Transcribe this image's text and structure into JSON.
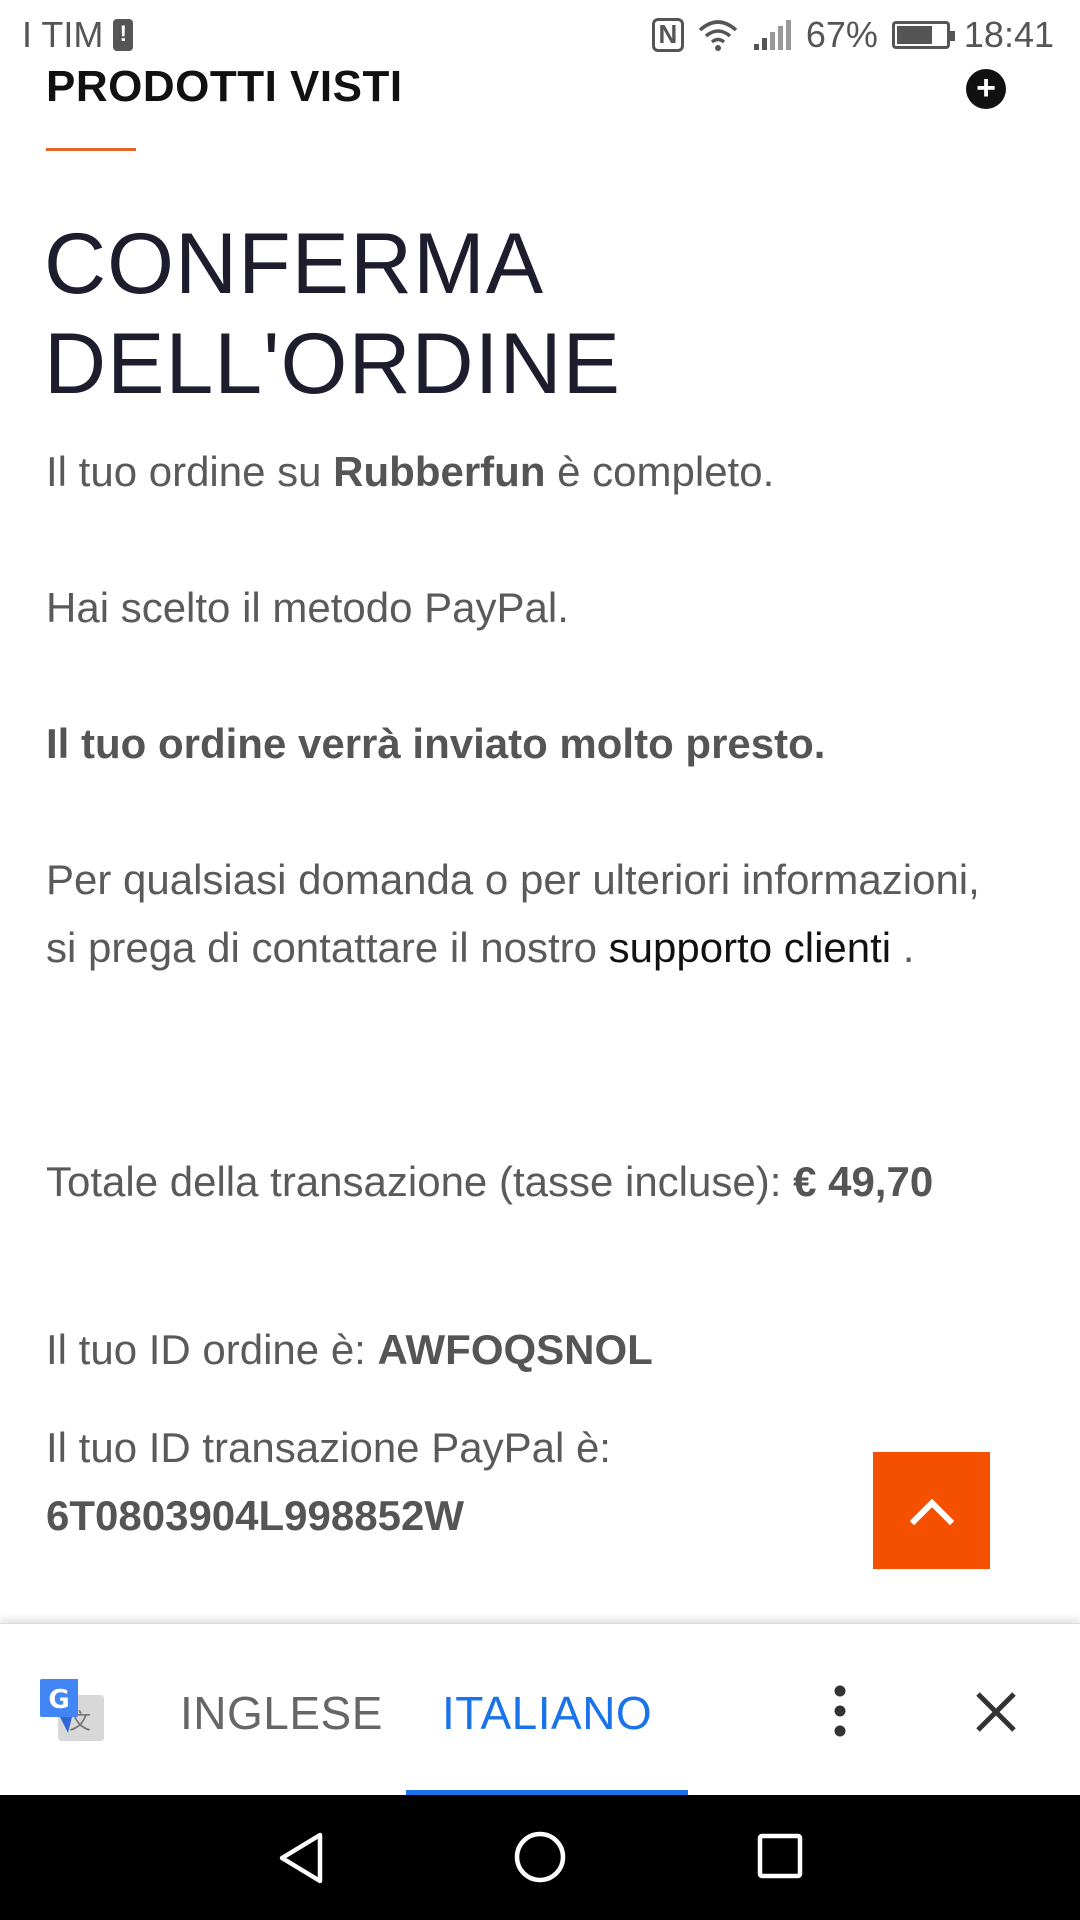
{
  "status_bar": {
    "carrier": "I TIM",
    "battery_percent": "67%",
    "time": "18:41",
    "battery_level": 0.67
  },
  "header": {
    "section_heading": "PRODOTTI VISTI",
    "underline_color": "#e3672a"
  },
  "main": {
    "title_line1": "CONFERMA",
    "title_line2": "DELL'ORDINE",
    "completed": {
      "prefix": "Il tuo ordine su ",
      "shop": "Rubberfun",
      "suffix": " è completo."
    },
    "payment_method": "Hai scelto il metodo PayPal.",
    "shipping_notice": "Il tuo ordine verrà inviato molto presto.",
    "contact": {
      "text": "Per qualsiasi domanda o per ulteriori informazioni, si prega di contattare il nostro ",
      "link": "supporto clienti",
      "end": " ."
    },
    "total": {
      "label": "Totale della transazione (tasse incluse): ",
      "value": "€ 49,70"
    },
    "order_id": {
      "label": "Il tuo ID ordine è: ",
      "value": "AWFOQSNOL"
    },
    "paypal_id": {
      "label": "Il tuo ID transazione PayPal è:",
      "value": "6T0803904L998852W"
    },
    "scroll_top_color": "#f45000"
  },
  "translate_bar": {
    "tab_source": "INGLESE",
    "tab_target": "ITALIANO",
    "active_color": "#1a73e8"
  },
  "icons": {
    "plus": "plus-circle-icon",
    "scroll_top": "chevron-up-icon",
    "translate": "google-translate-icon",
    "more": "more-vert-icon",
    "close": "close-icon",
    "back": "nav-back-icon",
    "home": "nav-home-icon",
    "recents": "nav-recents-icon"
  }
}
